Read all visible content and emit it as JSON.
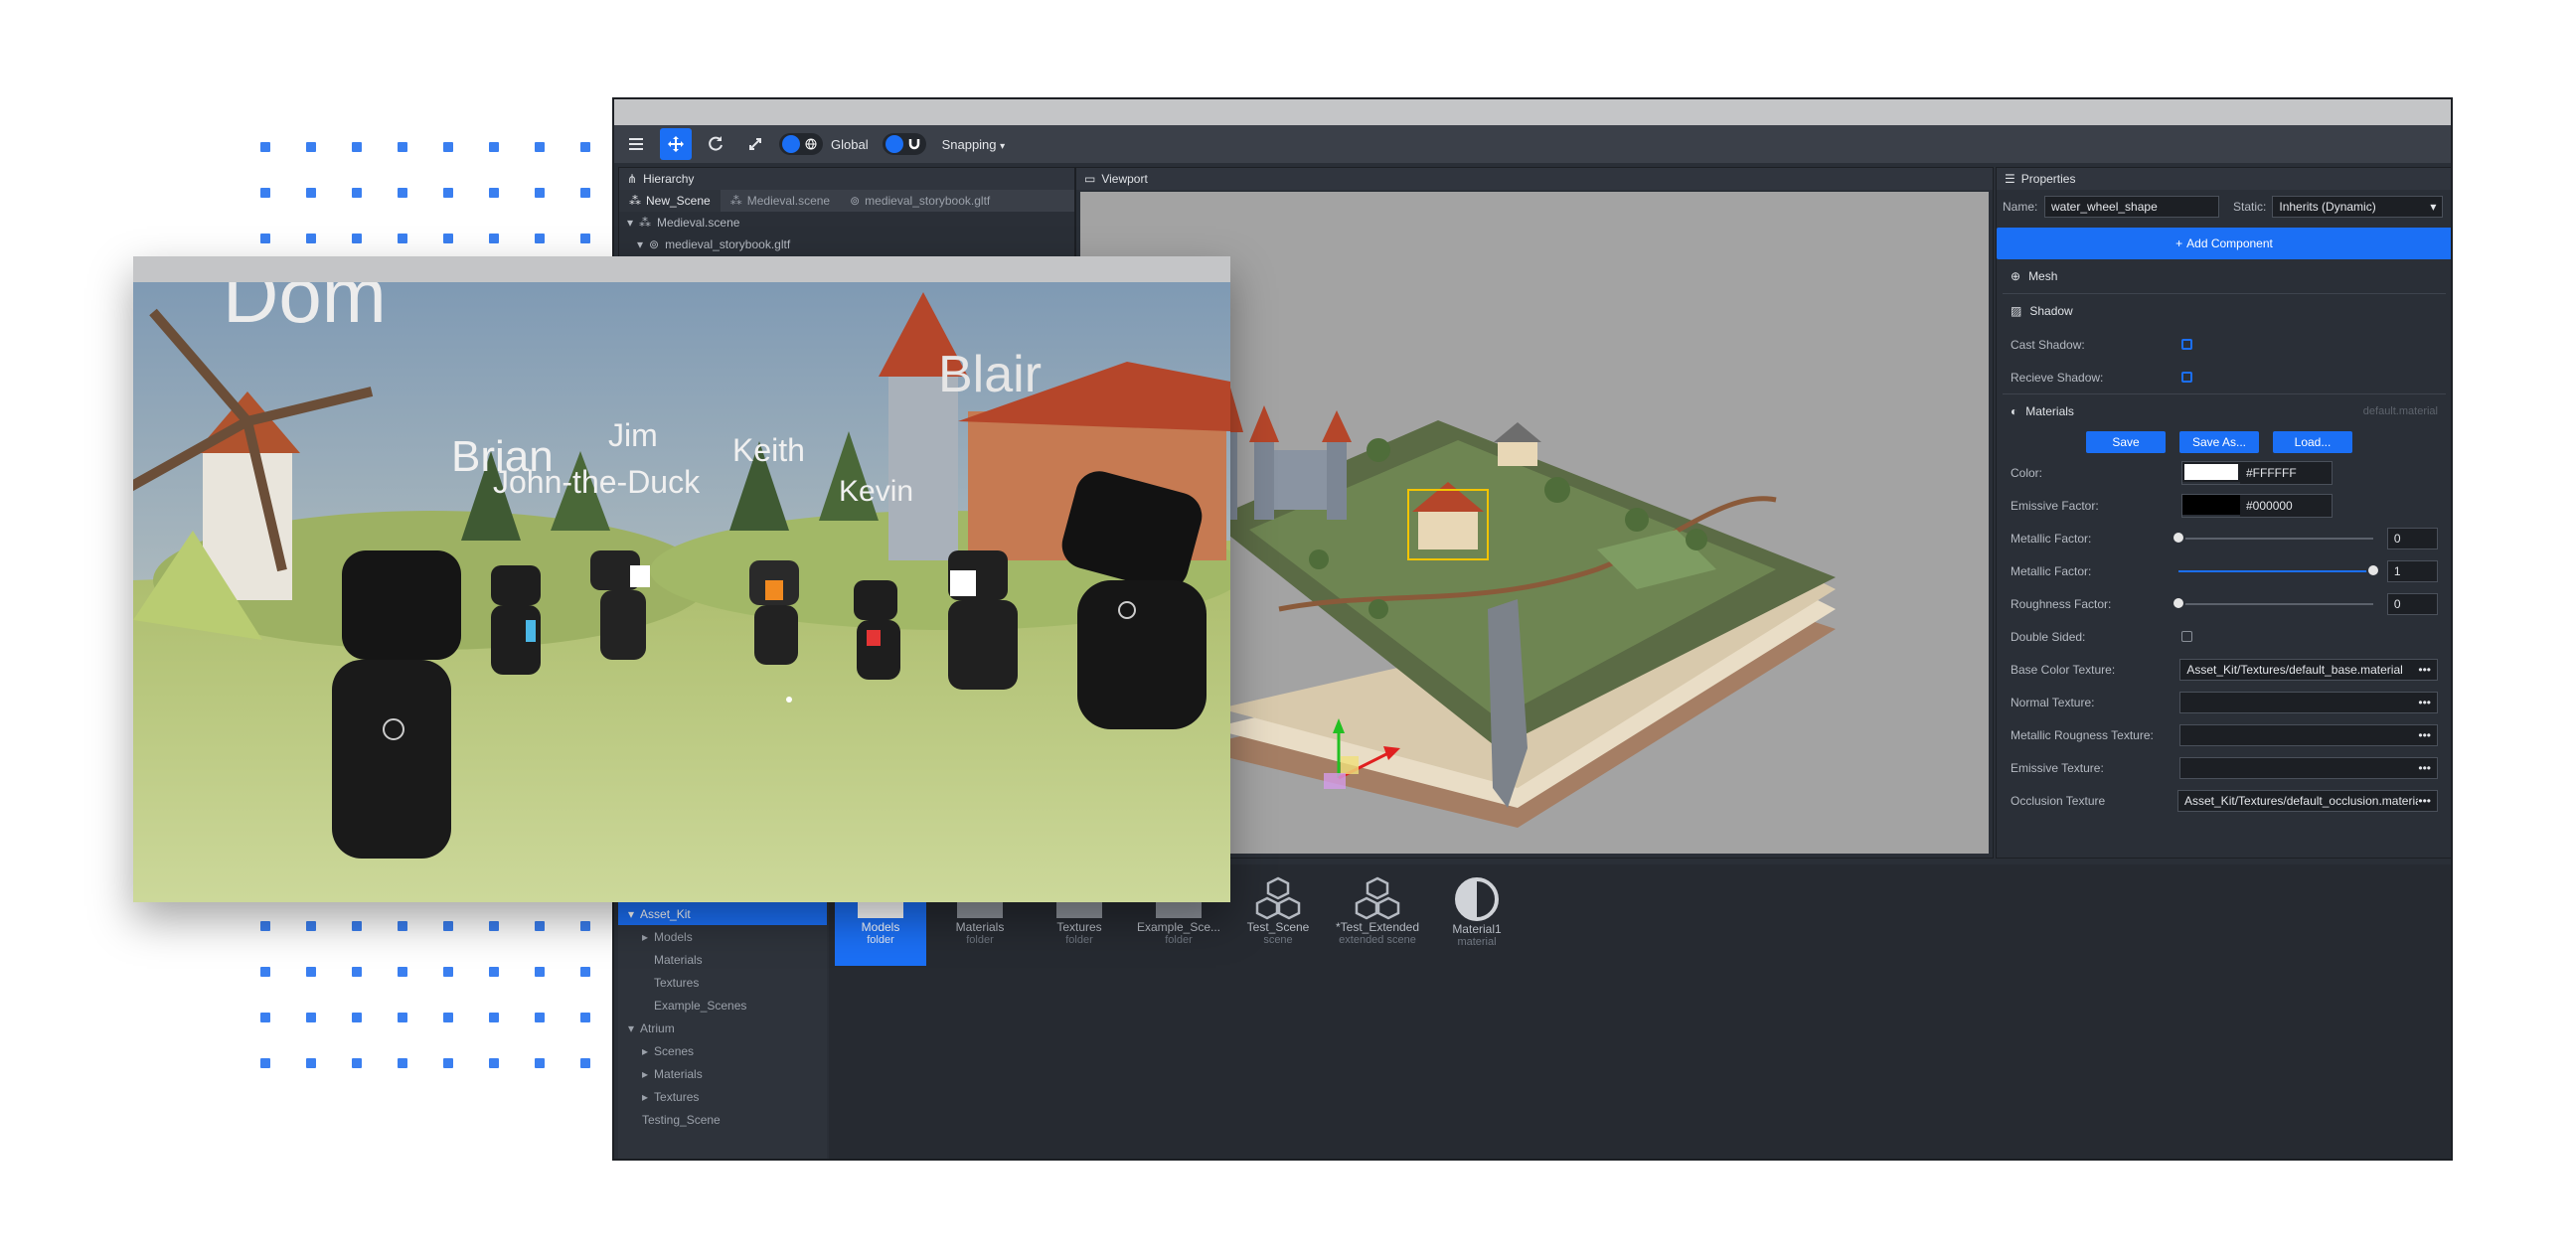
{
  "toolbar": {
    "menu_icon": "hamburger-icon",
    "move_icon": "move-icon",
    "rotate_icon": "rotate-icon",
    "scale_icon": "scale-icon",
    "space_label": "Global",
    "snapping_label": "Snapping"
  },
  "hierarchy": {
    "title": "Hierarchy",
    "tabs": [
      "New_Scene",
      "Medieval.scene",
      "medieval_storybook.gltf"
    ],
    "tree": [
      "Medieval.scene",
      "medieval_storybook.gltf"
    ]
  },
  "viewport": {
    "title": "Viewport"
  },
  "properties": {
    "title": "Properties",
    "name_label": "Name:",
    "name_value": "water_wheel_shape",
    "static_label": "Static:",
    "static_value": "Inherits (Dynamic)",
    "add_component": "Add Component",
    "mesh_section": "Mesh",
    "shadow_section": "Shadow",
    "cast_shadow": "Cast Shadow:",
    "receive_shadow": "Recieve Shadow:",
    "materials_section": "Materials",
    "material_name": "default.material",
    "save": "Save",
    "save_as": "Save As...",
    "load": "Load...",
    "color_label": "Color:",
    "color_value": "#FFFFFF",
    "emissive_label": "Emissive Factor:",
    "emissive_value": "#000000",
    "metallic1_label": "Metallic Factor:",
    "metallic1_value": "0",
    "metallic2_label": "Metallic Factor:",
    "metallic2_value": "1",
    "roughness_label": "Roughness Factor:",
    "roughness_value": "0",
    "double_sided_label": "Double Sided:",
    "base_color_tex_label": "Base Color Texture:",
    "base_color_tex_value": "Asset_Kit/Textures/default_base.material",
    "normal_tex_label": "Normal Texture:",
    "metal_rough_tex_label": "Metallic Rougness Texture:",
    "emissive_tex_label": "Emissive Texture:",
    "occlusion_tex_label": "Occlusion Texture",
    "occlusion_tex_value": "Asset_Kit/Textures/default_occlusion.material",
    "more": "•••",
    "colors": {
      "accent": "#1b6ff5",
      "white": "#ffffff",
      "black": "#000000"
    }
  },
  "assets": {
    "tree": [
      {
        "label": "Asset_Kit",
        "selected": true
      },
      {
        "label": "Models"
      },
      {
        "label": "Materials"
      },
      {
        "label": "Textures"
      },
      {
        "label": "Example_Scenes"
      },
      {
        "label": "Atrium"
      },
      {
        "label": "Scenes"
      },
      {
        "label": "Materials"
      },
      {
        "label": "Textures"
      },
      {
        "label": "Testing_Scene"
      }
    ],
    "tiles": [
      {
        "name": "Models",
        "type": "folder",
        "icon": "folder-icon"
      },
      {
        "name": "Materials",
        "type": "folder",
        "icon": "folder-icon"
      },
      {
        "name": "Textures",
        "type": "folder",
        "icon": "folder-icon"
      },
      {
        "name": "Example_Sce...",
        "type": "folder",
        "icon": "folder-icon"
      },
      {
        "name": "Test_Scene",
        "type": "scene",
        "icon": "cubes-icon"
      },
      {
        "name": "*Test_Extended",
        "type": "extended scene",
        "icon": "cubes-icon"
      },
      {
        "name": "Material1",
        "type": "material",
        "icon": "half-circle-icon"
      }
    ]
  },
  "overlay": {
    "names": [
      "Dom",
      "Blair",
      "Jim",
      "Keith",
      "Brian",
      "John-the-Duck",
      "Kevin"
    ]
  }
}
